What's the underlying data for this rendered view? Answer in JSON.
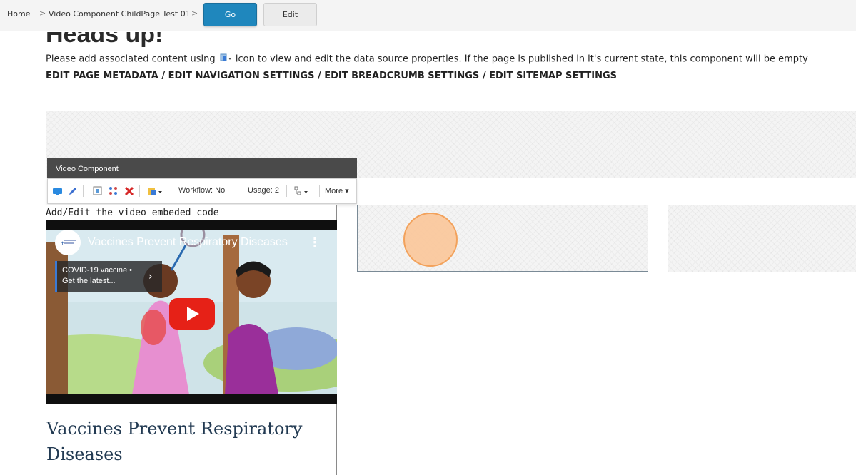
{
  "breadcrumb": {
    "home": "Home",
    "current": "Video Component ChildPage Test 01",
    "separator": ">"
  },
  "actions": {
    "go_label": "Go",
    "edit_label": "Edit"
  },
  "notice": {
    "heading": "Heads up!",
    "text_before_icon": "Please add associated content using",
    "text_after_icon": "icon to view and edit the data source properties. If the page is published in it's current state, this component will be empty",
    "edit_links": "EDIT PAGE METADATA / EDIT NAVIGATION SETTINGS / EDIT BREADCRUMB SETTINGS / EDIT SITEMAP SETTINGS"
  },
  "component": {
    "title": "Video Component",
    "workflow": "Workflow: No",
    "usage": "Usage: 2",
    "more": "More"
  },
  "video": {
    "embed_label": "Add/Edit the video embeded code",
    "title": "Vaccines Prevent Respiratory Diseases",
    "card_line1": "COVID-19 vaccine •",
    "card_line2": "Get the latest...",
    "heading": "Vaccines Prevent Respiratory Diseases"
  },
  "colors": {
    "go_button": "#1f87bd",
    "toolbar_header": "#4a4a4a",
    "video_heading": "#223a52",
    "cursor": "#f39a4c"
  }
}
